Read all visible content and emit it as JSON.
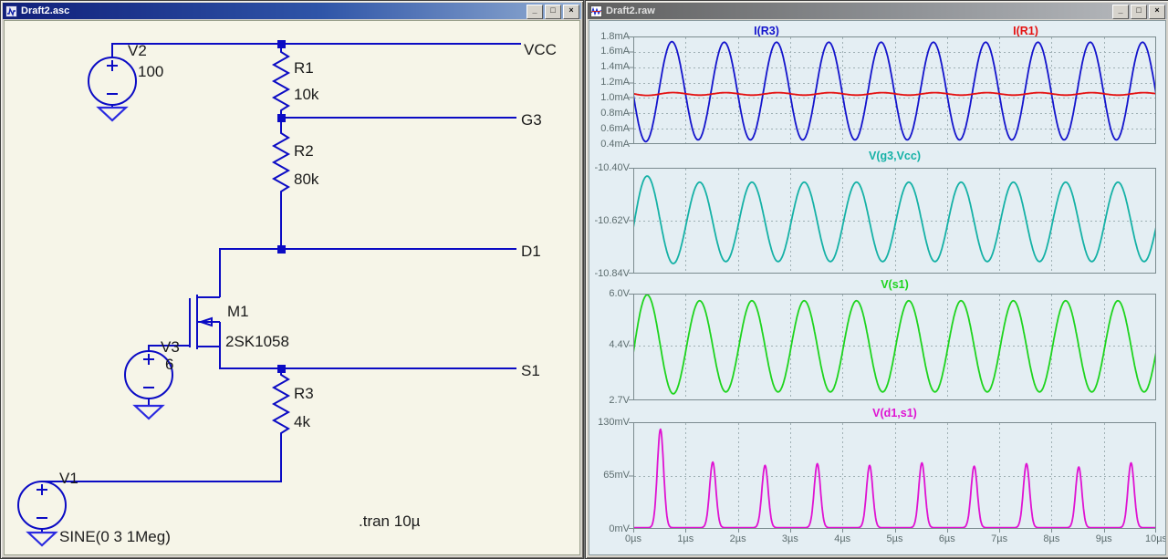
{
  "left_window": {
    "title": "Draft2.asc",
    "controls": {
      "minimize": "_",
      "maximize": "□",
      "close": "×"
    },
    "schematic": {
      "bg_color": "#f6f5e8",
      "wire_color": "#0b0bc4",
      "sources": {
        "v2": {
          "name": "V2",
          "value": "100"
        },
        "v3": {
          "name": "V3",
          "value": "6"
        },
        "v1": {
          "name": "V1",
          "value": "SINE(0 3 1Meg)"
        }
      },
      "resistors": {
        "r1": {
          "name": "R1",
          "value": "10k"
        },
        "r2": {
          "name": "R2",
          "value": "80k"
        },
        "r3": {
          "name": "R3",
          "value": "4k"
        }
      },
      "mosfet": {
        "name": "M1",
        "model": "2SK1058"
      },
      "nets": {
        "vcc": "VCC",
        "g3": "G3",
        "d1": "D1",
        "s1": "S1"
      },
      "directive": ".tran 10µ"
    }
  },
  "right_window": {
    "title": "Draft2.raw",
    "controls": {
      "minimize": "_",
      "maximize": "□",
      "close": "×"
    }
  },
  "chart_data": {
    "type": "line",
    "x": {
      "unit": "µs",
      "min": 0,
      "max": 10,
      "tick_step": 1,
      "tick_labels": [
        "0µs",
        "1µs",
        "2µs",
        "3µs",
        "4µs",
        "5µs",
        "6µs",
        "7µs",
        "8µs",
        "9µs",
        "10µs"
      ]
    },
    "panes": [
      {
        "ylim": [
          0.4,
          1.8
        ],
        "yticks": [
          {
            "value": 1.8,
            "label": "1.8mA"
          },
          {
            "value": 1.6,
            "label": "1.6mA"
          },
          {
            "value": 1.4,
            "label": "1.4mA"
          },
          {
            "value": 1.2,
            "label": "1.2mA"
          },
          {
            "value": 1.0,
            "label": "1.0mA"
          },
          {
            "value": 0.8,
            "label": "0.8mA"
          },
          {
            "value": 0.6,
            "label": "0.6mA"
          },
          {
            "value": 0.4,
            "label": "0.4mA"
          }
        ],
        "grid_lines": [
          1.6,
          1.4,
          1.2,
          1.0,
          0.8,
          0.6
        ],
        "series": [
          {
            "name": "I(R3)",
            "color": "#1414cc",
            "shape": "sine",
            "center": 1.09,
            "amplitude": 0.635,
            "first_cycle_amplitude": 0.665,
            "period_us": 1,
            "first_peak_us": 0.74
          },
          {
            "name": "I(R1)",
            "color": "#e41212",
            "shape": "sine",
            "center": 1.053,
            "amplitude": 0.016,
            "first_cycle_amplitude": 0.021,
            "period_us": 1,
            "first_peak_us": 0.77
          }
        ]
      },
      {
        "ylim": [
          -10.84,
          -10.4
        ],
        "yticks": [
          {
            "value": -10.4,
            "label": "-10.40V"
          },
          {
            "value": -10.62,
            "label": "-10.62V"
          },
          {
            "value": -10.84,
            "label": "-10.84V"
          }
        ],
        "grid_lines": [
          -10.62
        ],
        "series": [
          {
            "name": "V(g3,Vcc)",
            "color": "#15b1a6",
            "shape": "sine",
            "center": -10.625,
            "amplitude": 0.165,
            "first_cycle_amplitude": 0.2,
            "period_us": 1,
            "first_peak_us": 0.27
          }
        ]
      },
      {
        "ylim": [
          2.7,
          6.0
        ],
        "yticks": [
          {
            "value": 6.0,
            "label": "6.0V"
          },
          {
            "value": 4.4,
            "label": "4.4V"
          },
          {
            "value": 2.7,
            "label": "2.7V"
          }
        ],
        "grid_lines": [
          4.4
        ],
        "series": [
          {
            "name": "V(s1)",
            "color": "#1ed41e",
            "shape": "sine",
            "center": 4.37,
            "amplitude": 1.41,
            "first_cycle_amplitude": 1.66,
            "period_us": 1,
            "first_peak_us": 0.27
          }
        ]
      },
      {
        "ylim": [
          0,
          130
        ],
        "yticks": [
          {
            "value": 130,
            "label": "130mV"
          },
          {
            "value": 65,
            "label": "65mV"
          },
          {
            "value": 0,
            "label": "0mV"
          }
        ],
        "grid_lines": [
          65
        ],
        "series": [
          {
            "name": "V(d1,s1)",
            "color": "#df12d2",
            "shape": "pulse",
            "baseline": 1.5,
            "sigma_us": 0.085,
            "pulse_times_us": [
              0.52,
              1.52,
              2.52,
              3.52,
              4.52,
              5.52,
              6.52,
              7.52,
              8.52,
              9.52
            ],
            "pulse_heights": [
              120,
              80,
              76,
              78,
              76,
              79,
              75,
              78,
              74,
              79
            ]
          }
        ]
      }
    ]
  }
}
